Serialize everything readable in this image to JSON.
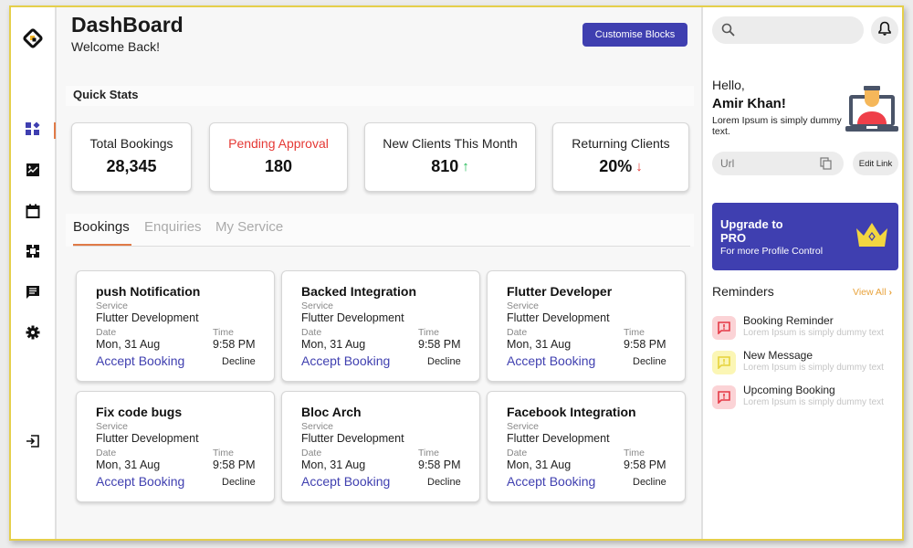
{
  "header": {
    "title": "DashBoard",
    "subtitle": "Welcome Back!",
    "customise_label": "Customise Blocks"
  },
  "sidebar": {
    "items": [
      {
        "name": "dashboard",
        "icon": "dashboard-icon",
        "active": true
      },
      {
        "name": "analytics",
        "icon": "chart-icon",
        "active": false
      },
      {
        "name": "calendar",
        "icon": "calendar-icon",
        "active": false
      },
      {
        "name": "services",
        "icon": "puzzle-icon",
        "active": false
      },
      {
        "name": "messages",
        "icon": "chat-icon",
        "active": false
      },
      {
        "name": "settings",
        "icon": "gear-icon",
        "active": false
      }
    ],
    "logout_icon": "logout-icon"
  },
  "quick_stats": {
    "label": "Quick Stats",
    "items": [
      {
        "label": "Total Bookings",
        "value": "28,345"
      },
      {
        "label": "Pending Approval",
        "value": "180",
        "label_color": "#e53935"
      },
      {
        "label": "New Clients This Month",
        "value": "810",
        "trend": "up",
        "trend_color": "#1db954"
      },
      {
        "label": "Returning Clients",
        "value": "20%",
        "trend": "down",
        "trend_color": "#e53935"
      }
    ]
  },
  "tabs": [
    {
      "label": "Bookings",
      "active": true
    },
    {
      "label": "Enquiries",
      "active": false
    },
    {
      "label": "My Service",
      "active": false
    }
  ],
  "bookings": [
    {
      "title": "push Notification",
      "service_label": "Service",
      "service": "Flutter Development",
      "date_label": "Date",
      "date": "Mon, 31 Aug",
      "time_label": "Time",
      "time": "9:58 PM",
      "accept": "Accept Booking",
      "decline": "Decline"
    },
    {
      "title": "Backed Integration",
      "service_label": "Service",
      "service": "Flutter Development",
      "date_label": "Date",
      "date": "Mon, 31 Aug",
      "time_label": "Time",
      "time": "9:58 PM",
      "accept": "Accept Booking",
      "decline": "Decline"
    },
    {
      "title": "Flutter Developer",
      "service_label": "Service",
      "service": "Flutter Development",
      "date_label": "Date",
      "date": "Mon, 31 Aug",
      "time_label": "Time",
      "time": "9:58 PM",
      "accept": "Accept Booking",
      "decline": "Decline"
    },
    {
      "title": "Fix code bugs",
      "service_label": "Service",
      "service": "Flutter Development",
      "date_label": "Date",
      "date": "Mon, 31 Aug",
      "time_label": "Time",
      "time": "9:58 PM",
      "accept": "Accept Booking",
      "decline": "Decline"
    },
    {
      "title": "Bloc Arch",
      "service_label": "Service",
      "service": "Flutter Development",
      "date_label": "Date",
      "date": "Mon, 31 Aug",
      "time_label": "Time",
      "time": "9:58 PM",
      "accept": "Accept Booking",
      "decline": "Decline"
    },
    {
      "title": "Facebook Integration",
      "service_label": "Service",
      "service": "Flutter Development",
      "date_label": "Date",
      "date": "Mon, 31 Aug",
      "time_label": "Time",
      "time": "9:58 PM",
      "accept": "Accept Booking",
      "decline": "Decline"
    }
  ],
  "profile": {
    "greeting": "Hello,",
    "name": "Amir Khan!",
    "description": "Lorem Ipsum is simply dummy text.",
    "url_placeholder": "Url",
    "edit_link_label": "Edit Link"
  },
  "upgrade": {
    "title": "Upgrade to PRO",
    "subtitle": "For more Profile Control"
  },
  "reminders": {
    "title": "Reminders",
    "view_all": "View All",
    "items": [
      {
        "name": "Booking Reminder",
        "desc": "Lorem Ipsum is simply dummy text",
        "bg": "#fbd3d6",
        "color": "#e53946"
      },
      {
        "name": "New Message",
        "desc": "Lorem Ipsum is simply dummy text",
        "bg": "#fbf6b5",
        "color": "#e6d23a"
      },
      {
        "name": "Upcoming Booking",
        "desc": "Lorem Ipsum is simply dummy text",
        "bg": "#fbd3d6",
        "color": "#e53946"
      }
    ]
  },
  "colors": {
    "primary": "#3f3fb0",
    "accent": "#e07a47",
    "frame": "#e5cf4a"
  }
}
